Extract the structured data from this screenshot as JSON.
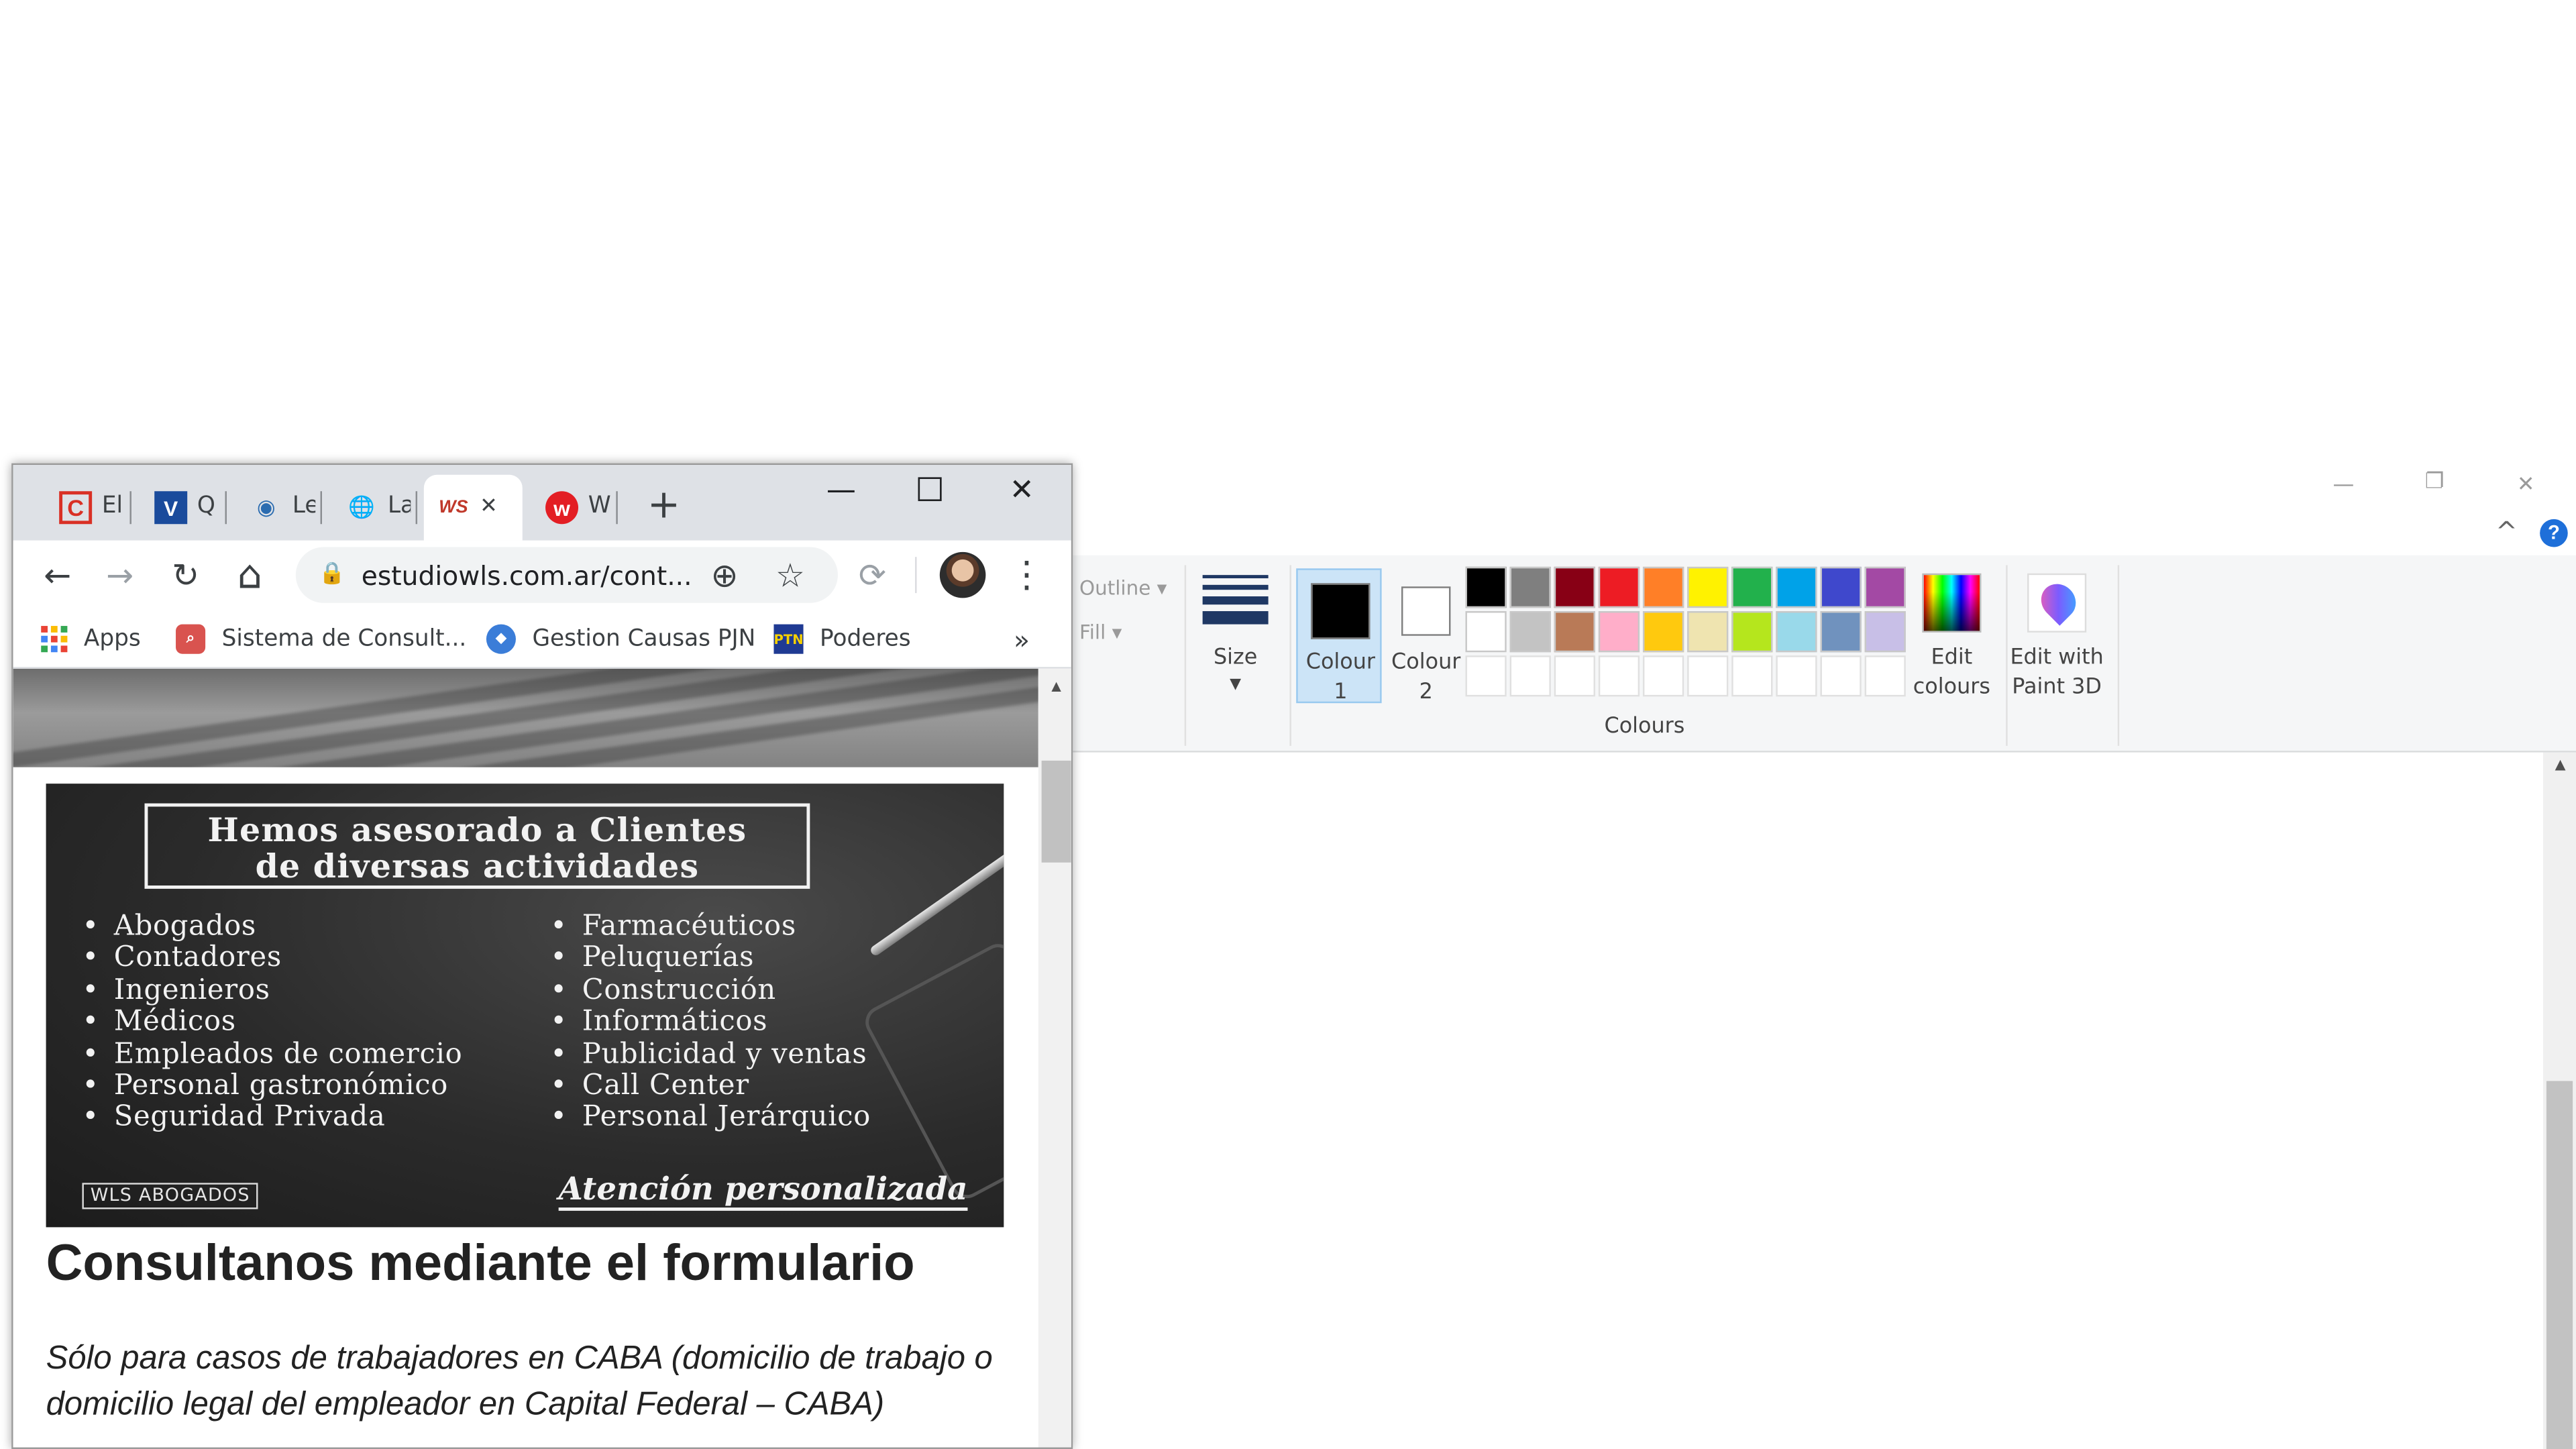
{
  "chrome": {
    "tabs": [
      {
        "title": "El",
        "icon": "c-red-icon",
        "favicon_text": "C",
        "favicon_color": "#d93025"
      },
      {
        "title": "Q",
        "icon": "v-blue-icon",
        "favicon_text": "V",
        "favicon_color": "#1a4b9c"
      },
      {
        "title": "Le",
        "icon": "seal-icon",
        "favicon_text": "◉",
        "favicon_color": "#2b6cb0"
      },
      {
        "title": "La",
        "icon": "globe-icon",
        "favicon_text": "🌐",
        "favicon_color": "#5f6368"
      },
      {
        "title": "",
        "icon": "ws-logo-icon",
        "favicon_text": "WS",
        "favicon_color": "#c0392b",
        "active": true
      },
      {
        "title": "W",
        "icon": "w-red-circle-icon",
        "favicon_text": "w",
        "favicon_color": "#e31e24"
      }
    ],
    "new_tab_label": "+",
    "close_tab_glyph": "✕",
    "window_controls": {
      "minimize": "—",
      "maximize": "☐",
      "close": "✕"
    },
    "toolbar": {
      "back": "←",
      "forward": "→",
      "reload": "↻",
      "home": "⌂",
      "lock": "🔒",
      "url": "estudiowls.com.ar/cont...",
      "zoom_icon": "⊕",
      "star_icon": "☆",
      "extension_icon": "⟳",
      "menu_icon": "⋮"
    },
    "bookmarks": [
      {
        "label": "Apps",
        "icon": "apps-grid-icon",
        "color": "#ea4335"
      },
      {
        "label": "Sistema de Consult...",
        "icon": "search-red-icon",
        "color": "#d9534f"
      },
      {
        "label": "Gestion Causas PJN",
        "icon": "pjn-icon",
        "color": "#3b7dd8"
      },
      {
        "label": "Poderes",
        "icon": "ptn-icon",
        "color": "#1f3a93",
        "icon_text": "PTN"
      }
    ],
    "bookmarks_overflow": "»",
    "page": {
      "banner": {
        "heading_line1": "Hemos asesorado a Clientes",
        "heading_line2": "de diversas actividades",
        "list_left": [
          "Abogados",
          "Contadores",
          "Ingenieros",
          "Médicos",
          "Empleados de comercio",
          "Personal gastronómico",
          "Seguridad Privada"
        ],
        "list_right": [
          "Farmacéuticos",
          "Peluquerías",
          "Construcción",
          "Informáticos",
          "Publicidad y ventas",
          "Call Center",
          "Personal Jerárquico"
        ],
        "logo": "WLS ABOGADOS",
        "tagline": "Atención personalizada"
      },
      "heading": "Consultanos mediante el formulario",
      "paragraph": "Sólo para casos de trabajadores en CABA (domicilio de trabajo o domicilio legal del empleador en Capital Federal – CABA)"
    }
  },
  "paint": {
    "window_controls": {
      "minimize": "—",
      "restore": "❐",
      "close": "✕"
    },
    "collapse_icon": "^",
    "help_icon": "?",
    "outline_label": "Outline",
    "fill_label": "Fill",
    "size_label": "Size",
    "colour1_label": "Colour 1",
    "colour2_label": "Colour 2",
    "colours_group_label": "Colours",
    "edit_colours_label": "Edit colours",
    "edit_3d_label": "Edit with Paint 3D",
    "colour1": "#000000",
    "colour2": "#ffffff",
    "palette_row1": [
      "#000000",
      "#7f7f7f",
      "#880015",
      "#ed1c24",
      "#ff7f27",
      "#fff200",
      "#22b14c",
      "#00a2e8",
      "#3f48cc",
      "#a349a4"
    ],
    "palette_row2": [
      "#ffffff",
      "#c3c3c3",
      "#b97a57",
      "#ffaec9",
      "#ffc90e",
      "#efe4b0",
      "#b5e61d",
      "#99d9ea",
      "#7092be",
      "#c8bfe7"
    ]
  }
}
